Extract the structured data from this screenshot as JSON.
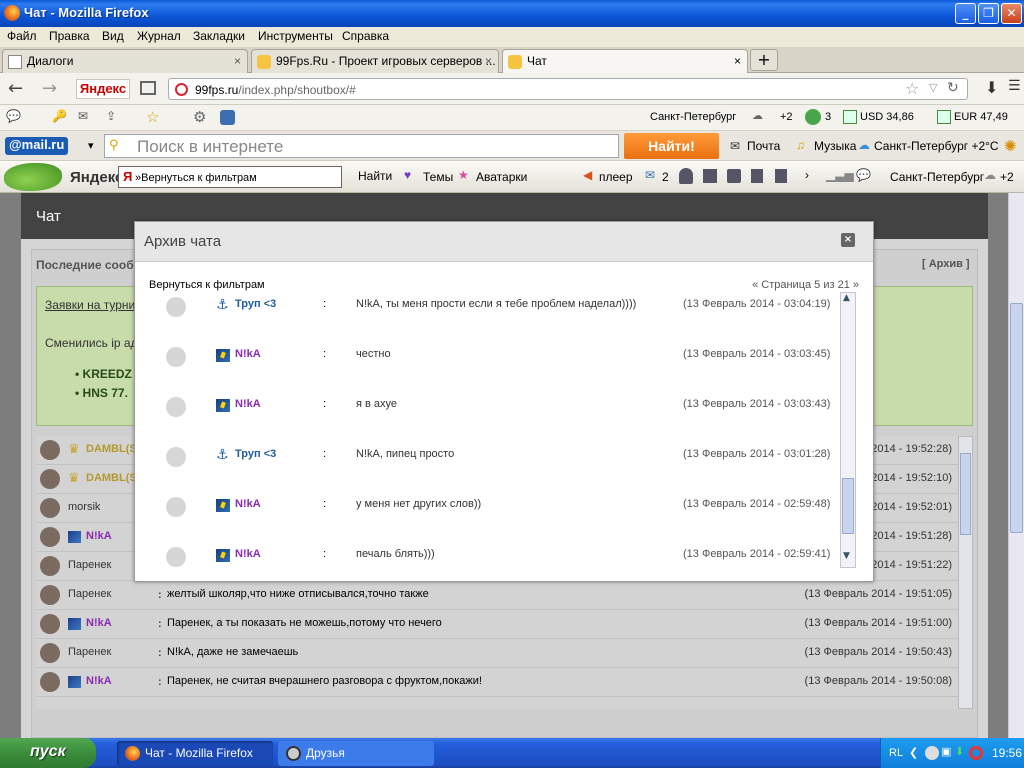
{
  "window": {
    "title": "Чат - Mozilla Firefox"
  },
  "menu": [
    "Файл",
    "Правка",
    "Вид",
    "Журнал",
    "Закладки",
    "Инструменты",
    "Справка"
  ],
  "tabs": [
    {
      "label": "Диалоги",
      "close": "×"
    },
    {
      "label": "99Fps.Ru - Проект игровых серверов ...",
      "close": "×"
    },
    {
      "label": "Чат",
      "close": "×"
    }
  ],
  "newtab": "+",
  "nav": {
    "yandex": "Яндекс",
    "url_host": "99fps.ru",
    "url_path": "/index.php/shoutbox/#"
  },
  "toolbar1": {
    "city": "Санкт-Петербург",
    "temp": "+2",
    "mail_count": "3",
    "usd": "USD 34,86",
    "eur": "EUR 47,49"
  },
  "toolbar2": {
    "logo": "@mail.ru",
    "search_placeholder": "Поиск в интернете",
    "find": "Найти!",
    "mail": "Почта",
    "music": "Музыка",
    "weather": "Санкт-Петербург +2°C"
  },
  "toolbar3": {
    "yandex": "Яндекс",
    "search_value": "»Вернуться к фильтрам",
    "find": "Найти",
    "themes": "Темы",
    "avatars": "Аватарки",
    "player": "плеер",
    "mail_count": "2",
    "city": "Санкт-Петербург",
    "temp": "+2"
  },
  "page": {
    "header": "Чат",
    "section_title": "Последние сообщ",
    "archive_link": "[ Архив ]",
    "tournament_link": "Заявки на турни",
    "ip_note": "Сменились ip ад",
    "servers": [
      "KREEDZ",
      "HNS 77."
    ]
  },
  "chat": [
    {
      "name": "DAMBL(S",
      "msg": "",
      "date": "2014 - 19:52:28)",
      "color": "#b39a2f"
    },
    {
      "name": "DAMBL(S",
      "msg": "",
      "date": "2014 - 19:52:10)",
      "color": "#b39a2f"
    },
    {
      "name": "morsik",
      "msg": "",
      "date": "2014 - 19:52:01)",
      "color": "#333333"
    },
    {
      "name": "N!kA",
      "msg": "",
      "date": "2014 - 19:51:28)",
      "color": "#8a2ab3"
    },
    {
      "name": "Паренек",
      "msg": "",
      "date": "2014 - 19:51:22)",
      "color": "#333333"
    },
    {
      "name": "Паренек",
      "msg": "желтый школяр,что ниже отписывался,точно также",
      "date": "(13 Февраль 2014 - 19:51:05)",
      "color": "#333333"
    },
    {
      "name": "N!kA",
      "msg": "Паренек, а ты показать не можешь,потому что нечего",
      "date": "(13 Февраль 2014 - 19:51:00)",
      "color": "#8a2ab3"
    },
    {
      "name": "Паренек",
      "msg": "N!kA, даже не замечаешь",
      "date": "(13 Февраль 2014 - 19:50:43)",
      "color": "#333333"
    },
    {
      "name": "N!kA",
      "msg": "Паренек, не считая вчерашнего разговора с фруктом,покажи!",
      "date": "(13 Февраль 2014 - 19:50:08)",
      "color": "#8a2ab3"
    }
  ],
  "modal": {
    "title": "Архив чата",
    "close": "×",
    "back": "Вернуться к фильтрам",
    "pager": "« Страница 5 из 21 »",
    "rows": [
      {
        "icon": "anchor",
        "name": "Труп <3",
        "color": "#1f5c9c",
        "msg": "N!kA, ты меня прости если я тебе проблем наделал))))",
        "date": "(13 Февраль 2014 - 03:04:19)"
      },
      {
        "icon": "flag",
        "name": "N!kA",
        "color": "#8a2ab3",
        "msg": "честно",
        "date": "(13 Февраль 2014 - 03:03:45)"
      },
      {
        "icon": "flag",
        "name": "N!kA",
        "color": "#8a2ab3",
        "msg": "я в ахуе",
        "date": "(13 Февраль 2014 - 03:03:43)"
      },
      {
        "icon": "anchor",
        "name": "Труп <3",
        "color": "#1f5c9c",
        "msg": "N!kA, пипец просто",
        "date": "(13 Февраль 2014 - 03:01:28)"
      },
      {
        "icon": "flag",
        "name": "N!kA",
        "color": "#8a2ab3",
        "msg": "у меня нет других слов))",
        "date": "(13 Февраль 2014 - 02:59:48)"
      },
      {
        "icon": "flag",
        "name": "N!kA",
        "color": "#8a2ab3",
        "msg": "печаль блять)))",
        "date": "(13 Февраль 2014 - 02:59:41)"
      }
    ]
  },
  "taskbar": {
    "start": "пуск",
    "items": [
      "Чат - Mozilla Firefox",
      "Друзья"
    ],
    "lang": "RL",
    "clock": "19:56"
  }
}
